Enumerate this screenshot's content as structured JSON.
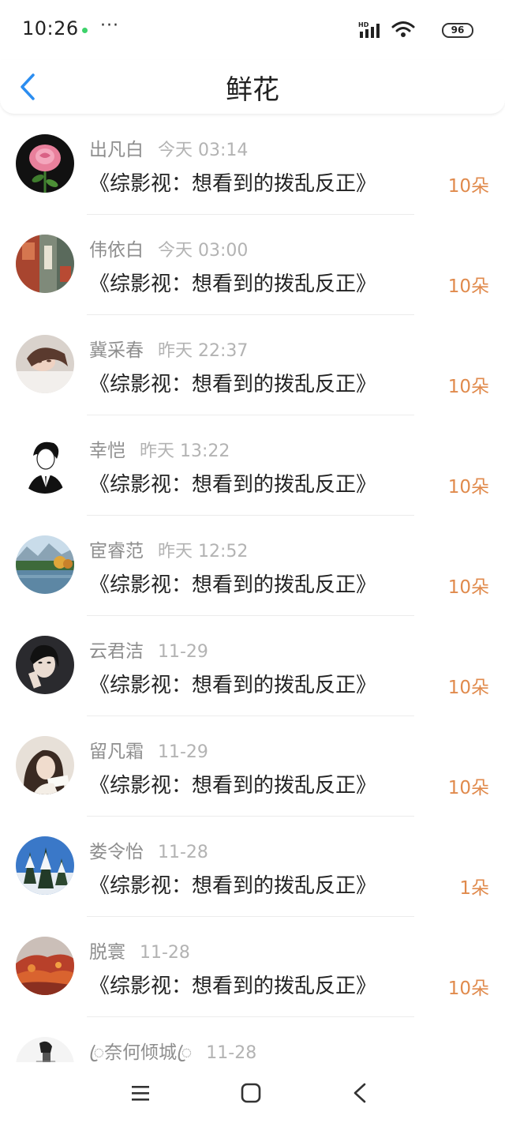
{
  "status_bar": {
    "time": "10:26",
    "more": "···",
    "network": "HD",
    "battery": "96"
  },
  "header": {
    "title": "鲜花",
    "back_icon": "chevron-left-icon"
  },
  "items": [
    {
      "name": "出凡白",
      "time": "今天 03:14",
      "title": "《综影视：想看到的拨乱反正》",
      "count": "10朵",
      "avatar": "rose"
    },
    {
      "name": "伟依白",
      "time": "今天 03:00",
      "title": "《综影视：想看到的拨乱反正》",
      "count": "10朵",
      "avatar": "collage"
    },
    {
      "name": "冀采春",
      "time": "昨天 22:37",
      "title": "《综影视：想看到的拨乱反正》",
      "count": "10朵",
      "avatar": "girl-lying"
    },
    {
      "name": "幸恺",
      "time": "昨天 13:22",
      "title": "《综影视：想看到的拨乱反正》",
      "count": "10朵",
      "avatar": "sketch-man"
    },
    {
      "name": "宦睿范",
      "time": "昨天 12:52",
      "title": "《综影视：想看到的拨乱反正》",
      "count": "10朵",
      "avatar": "lake"
    },
    {
      "name": "云君洁",
      "time": "11-29",
      "title": "《综影视：想看到的拨乱反正》",
      "count": "10朵",
      "avatar": "girl-dark"
    },
    {
      "name": "留凡霜",
      "time": "11-29",
      "title": "《综影视：想看到的拨乱反正》",
      "count": "10朵",
      "avatar": "girl-reading"
    },
    {
      "name": "娄令怡",
      "time": "11-28",
      "title": "《综影视：想看到的拨乱反正》",
      "count": "1朵",
      "avatar": "snow-trees"
    },
    {
      "name": "脱寰",
      "time": "11-28",
      "title": "《综影视：想看到的拨乱反正》",
      "count": "10朵",
      "avatar": "autumn"
    },
    {
      "name": "ꦿ奈何倾城ꦿ",
      "time": "11-28",
      "title": "",
      "count": "",
      "avatar": "ink-figure"
    }
  ],
  "nav": {
    "menu_icon": "menu-icon",
    "home_icon": "home-square-icon",
    "back_icon": "back-triangle-icon"
  }
}
